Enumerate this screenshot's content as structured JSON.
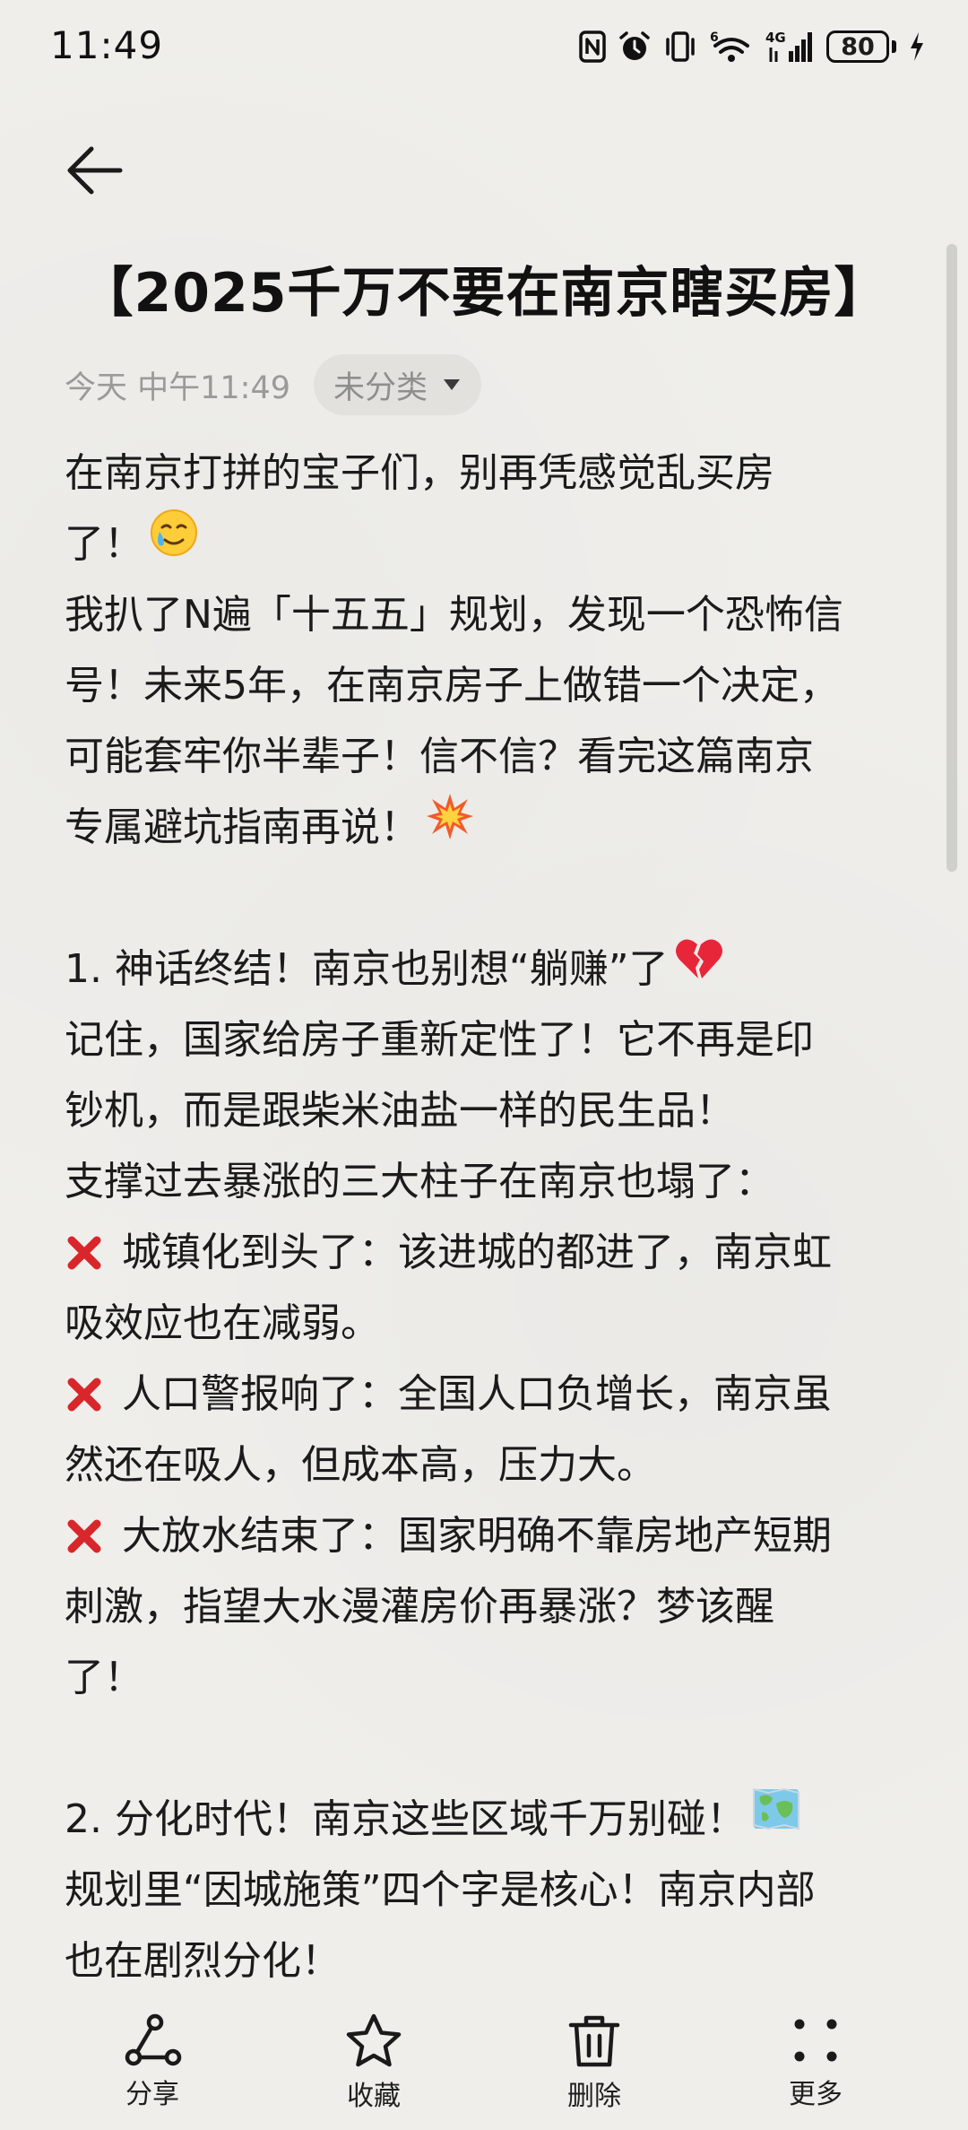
{
  "status_bar": {
    "time": "11:49",
    "battery": "80",
    "icons": [
      "nfc-icon",
      "alarm-icon",
      "vibrate-icon",
      "wifi-6-icon",
      "signal-4g-icon",
      "battery-icon",
      "charging-icon"
    ],
    "network_label": "4G",
    "wifi_label": "6"
  },
  "note": {
    "title": "【2025千万不要在南京瞎买房】",
    "meta_time": "今天 中午11:49",
    "category": "未分类"
  },
  "content": {
    "lines": [
      {
        "text": "在南京打拼的宝子们，别再凭感觉乱买房"
      },
      {
        "text": "了！",
        "emoji": "tearful-smile-emoji"
      },
      {
        "text": "我扒了N遍「十五五」规划，发现一个恐怖信"
      },
      {
        "text": "号！未来5年，在南京房子上做错一个决定，"
      },
      {
        "text": "可能套牢你半辈子！信不信？看完这篇南京"
      },
      {
        "text": "专属避坑指南再说！",
        "emoji": "collision-emoji"
      },
      {
        "text": ""
      },
      {
        "text": "1. 神话终结！南京也别想“躺赚”了",
        "emoji": "broken-heart-emoji"
      },
      {
        "text": "记住，国家给房子重新定性了！它不再是印"
      },
      {
        "text": "钞机，而是跟柴米油盐一样的民生品！"
      },
      {
        "text": "支撑过去暴涨的三大柱子在南京也塌了："
      },
      {
        "text": "城镇化到头了：该进城的都进了，南京虹",
        "cross": true
      },
      {
        "text": "吸效应也在减弱。"
      },
      {
        "text": "人口警报响了：全国人口负增长，南京虽",
        "cross": true
      },
      {
        "text": "然还在吸人，但成本高，压力大。"
      },
      {
        "text": "大放水结束了：国家明确不靠房地产短期",
        "cross": true
      },
      {
        "text": "刺激，指望大水漫灌房价再暴涨？梦该醒"
      },
      {
        "text": "了！"
      },
      {
        "text": ""
      },
      {
        "text": "2. 分化时代！南京这些区域千万别碰！",
        "emoji": "world-map-emoji"
      },
      {
        "text": "规划里“因城施策”四个字是核心！南京内部"
      },
      {
        "text": "也在剧烈分化！"
      }
    ]
  },
  "toolbar": {
    "share_label": "分享",
    "favorite_label": "收藏",
    "delete_label": "删除",
    "more_label": "更多"
  },
  "colors": {
    "background": "#efeeeb",
    "text": "#1b1b1b",
    "meta": "#9a9a98",
    "chip_bg": "#e2e1de",
    "cross_red": "#d8262b"
  }
}
